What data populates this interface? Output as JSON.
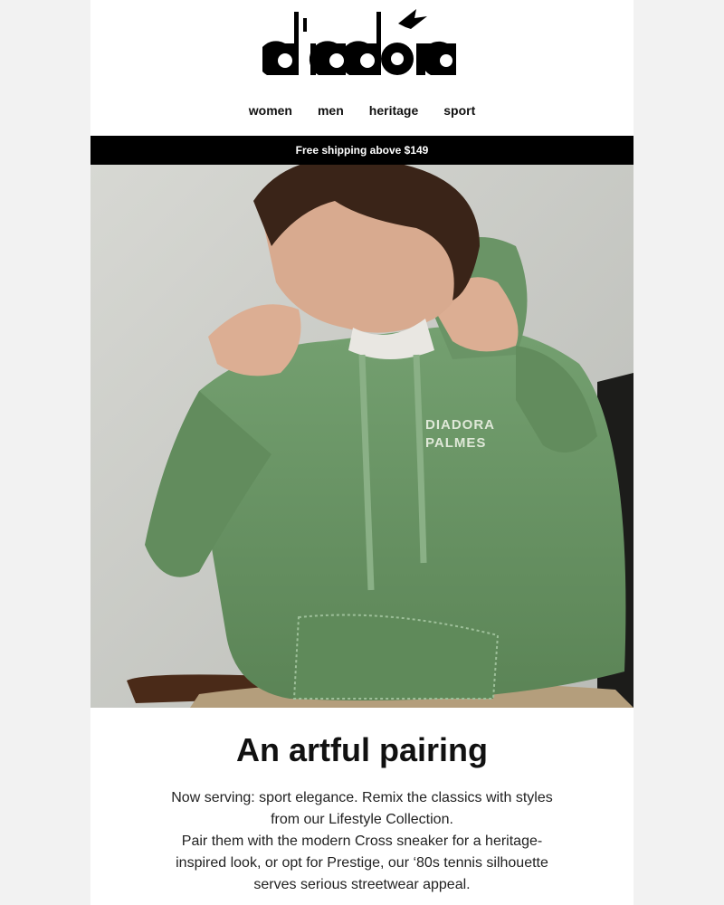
{
  "brand": {
    "logo_text": "diadora"
  },
  "nav": {
    "items": [
      "women",
      "men",
      "heritage",
      "sport"
    ]
  },
  "shipping_banner": "Free shipping above $149",
  "hero": {
    "garment_print": [
      "DIADORA",
      "PALMES"
    ],
    "colors": {
      "background": "#cfd0cb",
      "hoodie": "#6b9466"
    }
  },
  "content": {
    "headline": "An artful pairing",
    "paragraph_1": "Now serving: sport elegance. Remix the classics with styles from our Lifestyle Collection.",
    "paragraph_2": "Pair them with the modern Cross sneaker for a heritage-inspired look, or opt for Prestige, our ‘80s tennis silhouette serves serious streetwear appeal."
  }
}
